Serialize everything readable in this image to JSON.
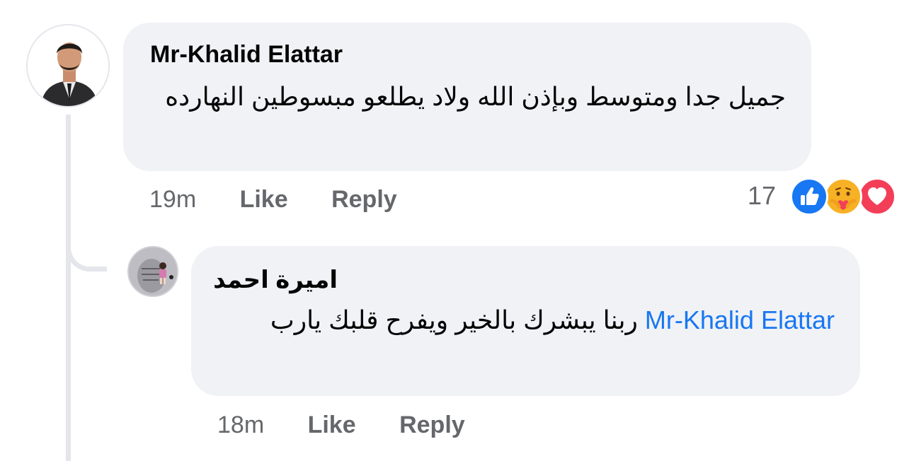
{
  "main_comment": {
    "author": "Mr-Khalid Elattar",
    "text": "جميل  جدا ومتوسط وبإذن الله ولاد يطلعو مبسوطين النهارده",
    "time": "19m",
    "like_label": "Like",
    "reply_label": "Reply",
    "reaction_count": "17",
    "reactions": [
      "like-icon",
      "care-icon",
      "love-icon"
    ]
  },
  "reply_comment": {
    "author": "اميرة احمد",
    "mention": "Mr-Khalid Elattar",
    "text": "ربنا يبشرك بالخير ويفرح قلبك يارب",
    "time": "18m",
    "like_label": "Like",
    "reply_label": "Reply"
  },
  "colors": {
    "bubble": "#f0f2f5",
    "meta": "#65676b",
    "mention": "#1877f2",
    "like": "#1877f2",
    "care": "#f7b125",
    "love": "#f33e58"
  }
}
